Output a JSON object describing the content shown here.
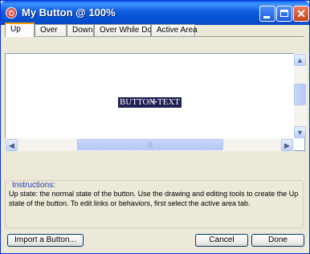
{
  "window": {
    "title": "My Button @  100%"
  },
  "tabs": [
    {
      "label": "Up"
    },
    {
      "label": "Over"
    },
    {
      "label": "Down"
    },
    {
      "label": "Over While Down"
    },
    {
      "label": "Active Area"
    }
  ],
  "canvas": {
    "button_text": "BUTTON TEXT"
  },
  "instructions": {
    "label": "Instructions:",
    "text": "Up state: the normal state of the button. Use the drawing and editing tools to create the Up state of the button. To edit links or behaviors, first select the active area tab."
  },
  "buttons": {
    "import": "Import a Button...",
    "cancel": "Cancel",
    "done": "Done"
  },
  "icons": {
    "app": "app-logo-icon",
    "minimize": "minimize-icon",
    "maximize": "maximize-icon",
    "close": "close-icon",
    "scroll_up": "arrow-up-icon",
    "scroll_down": "arrow-down-icon",
    "scroll_left": "arrow-left-icon",
    "scroll_right": "arrow-right-icon"
  }
}
